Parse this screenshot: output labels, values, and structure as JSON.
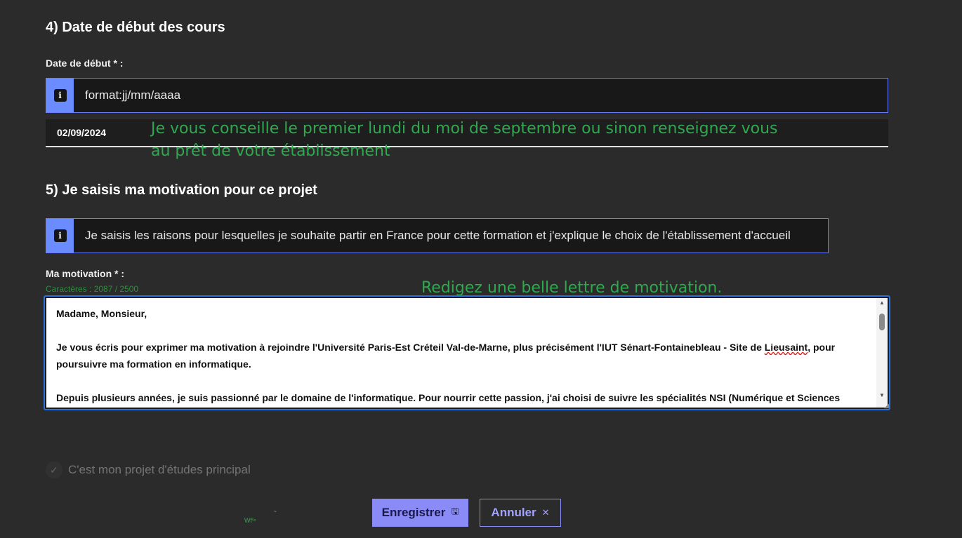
{
  "section4": {
    "title": "4) Date de début des cours",
    "date_label": "Date de début * :",
    "info_text": "format:jj/mm/aaaa",
    "date_value": "02/09/2024"
  },
  "annotations": {
    "date_advice": "Je vous conseille le premier lundi du moi de septembre ou sinon renseignez vous au prêt de votre établissement",
    "motivation_advice": "Redigez une belle lettre de motivation."
  },
  "section5": {
    "title": "5) Je saisis ma motivation pour ce projet",
    "info_text": "Je saisis les raisons pour lesquelles je souhaite partir en France pour cette formation et j'explique le choix de l'établissement d'accueil",
    "motivation_label": "Ma motivation * :",
    "char_counter": "Caractères : 2087 / 2500",
    "letter": {
      "salutation": "Madame, Monsieur,",
      "p1_before": "Je vous écris pour exprimer ma motivation à rejoindre l'Université Paris-Est Créteil Val-de-Marne, plus précisément l'IUT Sénart-Fontainebleau - Site de ",
      "p1_misspelled": "Lieusaint",
      "p1_after": ", pour poursuivre ma formation en informatique.",
      "p2": "Depuis plusieurs années, je suis passionné par le domaine de l'informatique. Pour nourrir cette passion, j'ai choisi de suivre les spécialités NSI (Numérique et Sciences Informatiques) et Mathématiques. J'ai également choisi l'option SNT, ce qui m'a permis de développer mes compétences en programmation et de découvrir la théorie."
    }
  },
  "main_project": {
    "label": "C'est mon projet d'études principal",
    "checked": true,
    "disabled": true
  },
  "buttons": {
    "save_label": "Enregistrer",
    "save_icon": "floppy-disk-icon",
    "cancel_label": "Annuler",
    "cancel_icon": "close-icon"
  },
  "stray_text": {
    "mark_1": "Wf⁽ⁿ",
    "mark_2": "~"
  },
  "colors": {
    "background": "#2b2b2b",
    "accent": "#8b8bf8",
    "info_icon_bg": "#6b8cff",
    "annotation_green": "#2fa84f",
    "textarea_focus": "#2c6fd6"
  }
}
